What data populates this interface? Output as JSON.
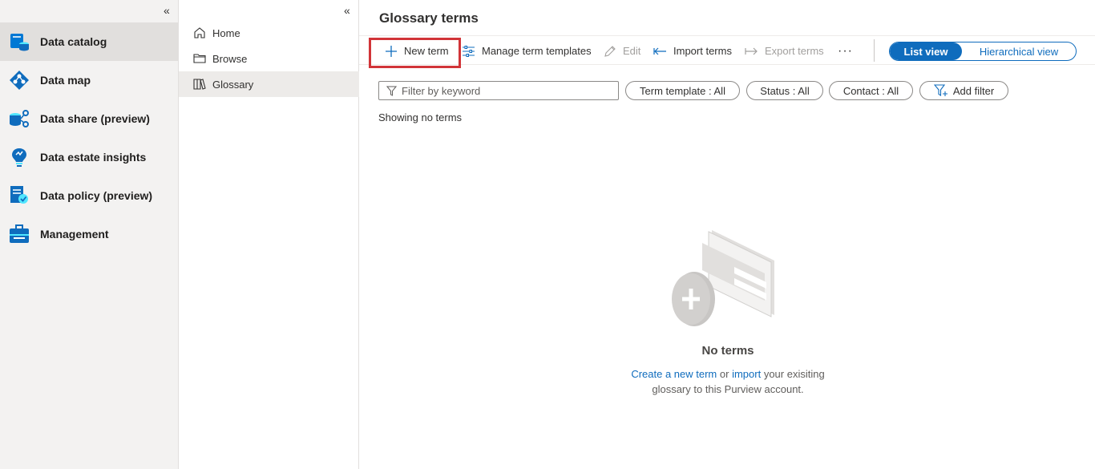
{
  "nav_primary": {
    "items": [
      {
        "label": "Data catalog",
        "icon": "data-catalog-icon"
      },
      {
        "label": "Data map",
        "icon": "data-map-icon"
      },
      {
        "label": "Data share (preview)",
        "icon": "data-share-icon"
      },
      {
        "label": "Data estate insights",
        "icon": "insights-bulb-icon"
      },
      {
        "label": "Data policy (preview)",
        "icon": "data-policy-icon"
      },
      {
        "label": "Management",
        "icon": "toolbox-icon"
      }
    ],
    "active": "Data catalog",
    "collapse_glyph": "«"
  },
  "nav_secondary": {
    "items": [
      {
        "label": "Home",
        "icon": "home-icon"
      },
      {
        "label": "Browse",
        "icon": "folder-icon"
      },
      {
        "label": "Glossary",
        "icon": "book-icon"
      }
    ],
    "active": "Glossary",
    "collapse_glyph": "«"
  },
  "main": {
    "title": "Glossary terms",
    "toolbar": {
      "new_term": "New term",
      "manage_templates": "Manage term templates",
      "edit": "Edit",
      "import_terms": "Import terms",
      "export_terms": "Export terms",
      "more": "···"
    },
    "view_toggle": {
      "list": "List view",
      "hierarchical": "Hierarchical view",
      "selected": "List view"
    },
    "filters": {
      "keyword_placeholder": "Filter by keyword",
      "term_template": "Term template : All",
      "status": "Status : All",
      "contact": "Contact : All",
      "add_filter": "Add filter"
    },
    "showing_text": "Showing no terms",
    "empty_state": {
      "title": "No terms",
      "create_link": "Create a new term",
      "or_text": "or",
      "import_link": "import",
      "desc_line1_rest": "your exisiting",
      "desc_line2": "glossary to this Purview account."
    }
  },
  "colors": {
    "accent": "#0f6cbd",
    "highlight_border": "#d13438",
    "nav_bg": "#f3f2f1"
  }
}
